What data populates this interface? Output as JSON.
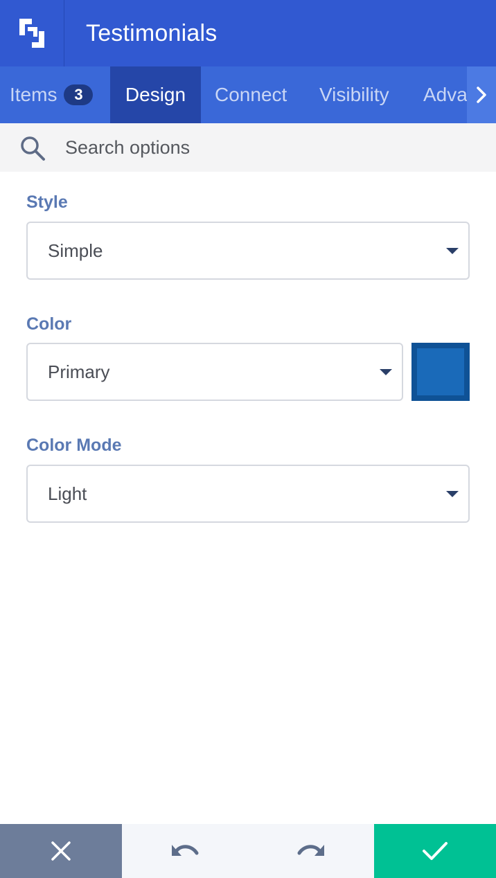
{
  "header": {
    "title": "Testimonials",
    "logo_icon": "logo-icon"
  },
  "tabs": [
    {
      "label": "Items",
      "badge": "3"
    },
    {
      "label": "Design"
    },
    {
      "label": "Connect"
    },
    {
      "label": "Visibility"
    },
    {
      "label": "Adva"
    }
  ],
  "tab_scroll_icon": "chevron-right-icon",
  "search": {
    "icon": "search-icon",
    "placeholder": "Search options",
    "value": ""
  },
  "fields": {
    "style": {
      "label": "Style",
      "value": "Simple"
    },
    "color": {
      "label": "Color",
      "value": "Primary",
      "swatch_color": "#1a6ab9"
    },
    "color_mode": {
      "label": "Color Mode",
      "value": "Light"
    }
  },
  "footer": {
    "cancel_icon": "close-icon",
    "undo_icon": "undo-icon",
    "redo_icon": "redo-icon",
    "save_icon": "check-icon"
  },
  "colors": {
    "header_bg": "#3159d1",
    "tab_bg": "#3a68d8",
    "active_tab_bg": "#2546a8",
    "label_color": "#5a79b3",
    "save_bg": "#00c194",
    "cancel_bg": "#6d7d9a"
  }
}
